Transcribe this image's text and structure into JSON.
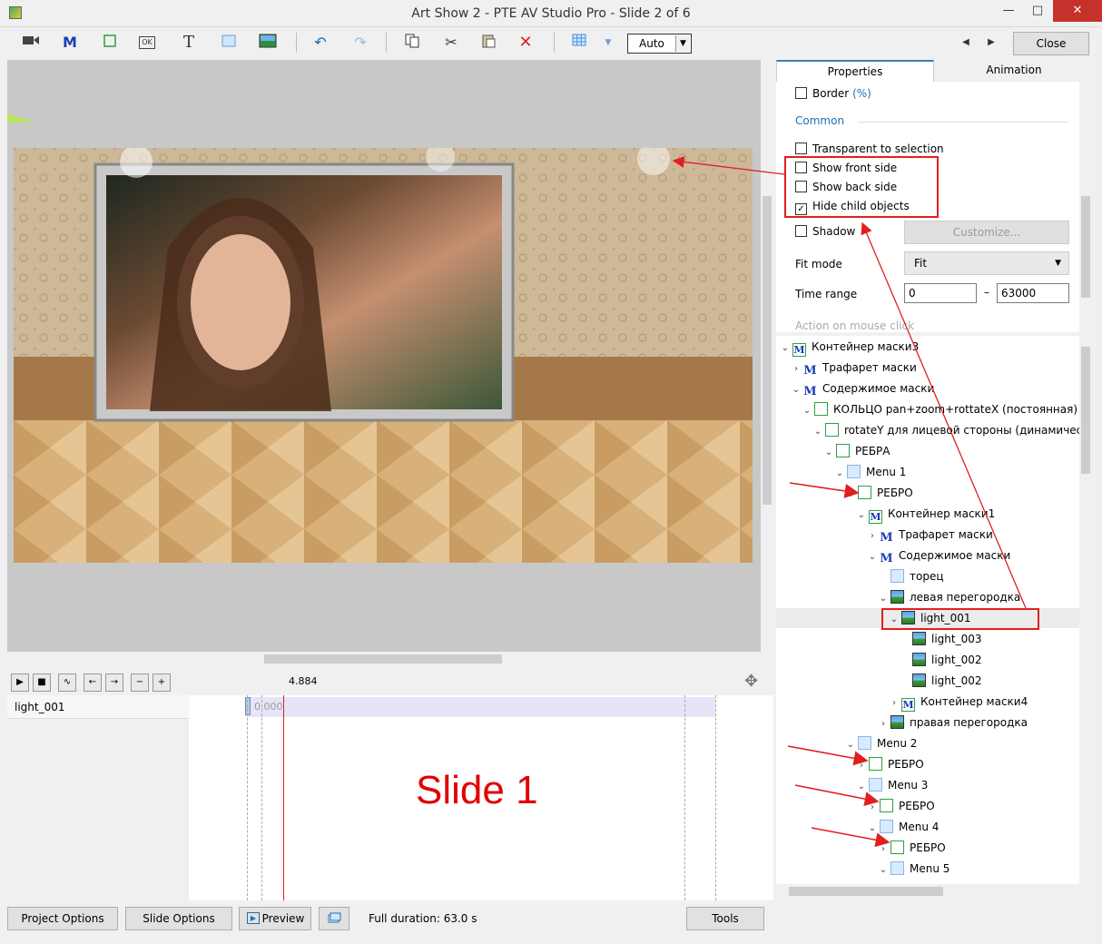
{
  "window": {
    "title": "Art Show 2 - PTE AV Studio Pro - Slide 2 of 6",
    "min_glyph": "—",
    "max_glyph": "□",
    "close_glyph": "✕"
  },
  "toolbar": {
    "mask_glyph": "M",
    "text_glyph": "T",
    "button_glyph": "OK",
    "zoom_value": "Auto",
    "close_label": "Close"
  },
  "timeline": {
    "position": "4.884",
    "object_label": "light_001",
    "clip_start": "0.000",
    "slide_overlay": "Slide 1"
  },
  "tabs": {
    "properties": "Properties",
    "animation": "Animation"
  },
  "properties": {
    "border_label": "Border",
    "border_unit": "(%)",
    "common_section": "Common",
    "transparent_label": "Transparent to selection",
    "show_front_label": "Show front side",
    "show_back_label": "Show back side",
    "hide_child_label": "Hide child objects",
    "hide_child_checked": true,
    "shadow_label": "Shadow",
    "customize_label": "Customize...",
    "fit_mode_label": "Fit mode",
    "fit_mode_value": "Fit",
    "time_range_label": "Time range",
    "time_start": "0",
    "time_dash": "–",
    "time_end": "63000",
    "action_label": "Action on mouse click"
  },
  "tree": {
    "items": [
      {
        "label": "Контейнер маски3",
        "icon": "mask"
      },
      {
        "label": "Трафарет маски",
        "icon": "stencil"
      },
      {
        "label": "Содержимое маски",
        "icon": "stencil"
      },
      {
        "label": "КОЛЬЦО pan+zoom+rottateX (постоянная)",
        "icon": "frame"
      },
      {
        "label": "rotateY для лицевой стороны (динамическая)",
        "icon": "frame"
      },
      {
        "label": "РЕБРА",
        "icon": "frame"
      },
      {
        "label": "Menu 1",
        "icon": "menu"
      },
      {
        "label": "РЕБРО",
        "icon": "frame"
      },
      {
        "label": "Контейнер маски1",
        "icon": "mask"
      },
      {
        "label": "Трафарет маски",
        "icon": "stencil"
      },
      {
        "label": "Содержимое маски",
        "icon": "stencil"
      },
      {
        "label": "торец",
        "icon": "menu"
      },
      {
        "label": "левая перегородка",
        "icon": "image"
      },
      {
        "label": "light_001",
        "icon": "image"
      },
      {
        "label": "light_003",
        "icon": "image"
      },
      {
        "label": "light_002",
        "icon": "image"
      },
      {
        "label": "light_002",
        "icon": "image"
      },
      {
        "label": "Контейнер маски4",
        "icon": "mask"
      },
      {
        "label": "правая перегородка",
        "icon": "image"
      },
      {
        "label": "Menu 2",
        "icon": "menu"
      },
      {
        "label": "РЕБРО",
        "icon": "frame"
      },
      {
        "label": "Menu 3",
        "icon": "menu"
      },
      {
        "label": "РЕБРО",
        "icon": "frame"
      },
      {
        "label": "Menu 4",
        "icon": "menu"
      },
      {
        "label": "РЕБРО",
        "icon": "frame"
      },
      {
        "label": "Menu 5",
        "icon": "menu"
      }
    ]
  },
  "bottom": {
    "project_options": "Project Options",
    "slide_options": "Slide Options",
    "preview": "Preview",
    "full_duration": "Full duration: 63.0 s",
    "tools": "Tools"
  },
  "colors": {
    "accent": "#3c7fb1",
    "annotation": "#e02020",
    "section": "#1e6fb0"
  }
}
